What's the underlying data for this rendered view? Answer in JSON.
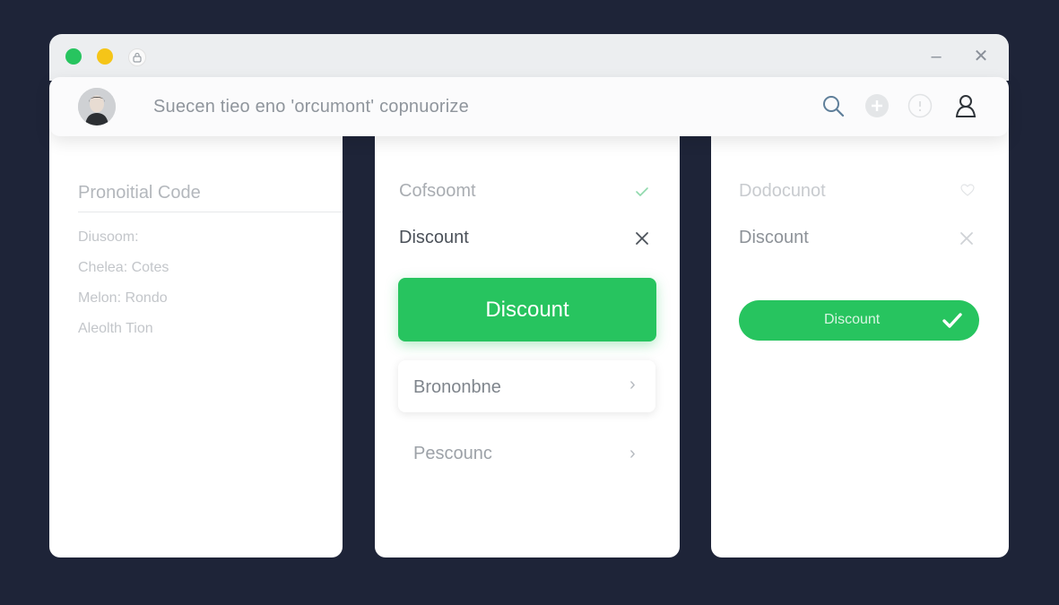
{
  "window": {
    "controls": {
      "minimize": "–",
      "close": "✕"
    },
    "header": {
      "title": "Suecen tieo eno 'orcumont' copnuorize",
      "icons": [
        "search-icon",
        "plus-icon",
        "info-icon",
        "user-icon"
      ]
    }
  },
  "left_panel": {
    "title": "Pronoitial Code",
    "items": [
      "Diusoom:",
      "Chelea: Cotes",
      "Melon: Rondo",
      "Aleolth Tion"
    ]
  },
  "middle_panel": {
    "row1": "Cofsoomt",
    "row2": "Discount",
    "primary_button": "Discount",
    "list_items": [
      "Brononbne",
      "Pescounc"
    ],
    "chevron": "›"
  },
  "right_panel": {
    "row1": "Dodocunot",
    "row2": "Discount",
    "success_button": "Discount"
  },
  "colors": {
    "background": "#1e2438",
    "accent": "#27c45f",
    "traffic_yellow": "#f5c518"
  }
}
